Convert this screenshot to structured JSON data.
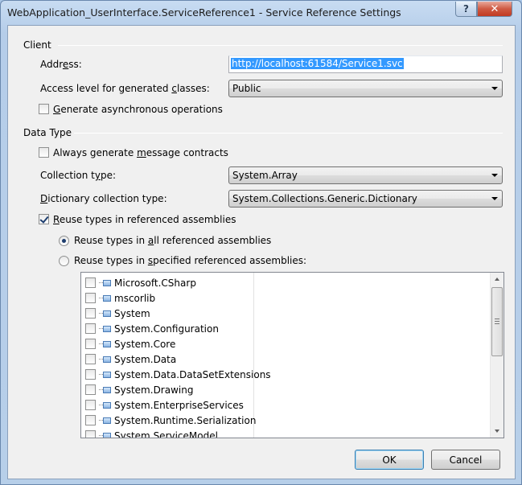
{
  "window": {
    "title": "WebApplication_UserInterface.ServiceReference1 - Service Reference Settings",
    "help_glyph": "?",
    "close_glyph": "✕"
  },
  "client": {
    "section_label": "Client",
    "address_label_pre": "Addr",
    "address_label_u": "e",
    "address_label_post": "ss:",
    "address_value": "http://localhost:61584/Service1.svc",
    "access_label_pre": "Access level for generated ",
    "access_label_u": "c",
    "access_label_post": "lasses:",
    "access_value": "Public",
    "async_u": "G",
    "async_post": "enerate asynchronous operations",
    "async_checked": false
  },
  "data_type": {
    "section_label": "Data Type",
    "message_pre": "Always generate ",
    "message_u": "m",
    "message_post": "essage contracts",
    "message_checked": false,
    "collection_label_pre": "Collection t",
    "collection_label_u": "y",
    "collection_label_post": "pe:",
    "collection_value": "System.Array",
    "dictionary_label_u": "D",
    "dictionary_label_post": "ictionary collection type:",
    "dictionary_value": "System.Collections.Generic.Dictionary",
    "reuse_u": "R",
    "reuse_post": "euse types in referenced assemblies",
    "reuse_checked": true,
    "reuse_all_pre": "Reuse types in ",
    "reuse_all_u": "a",
    "reuse_all_post": "ll referenced assemblies",
    "reuse_all_selected": true,
    "reuse_specified_pre": "Reuse types in ",
    "reuse_specified_u": "s",
    "reuse_specified_post": "pecified referenced assemblies:",
    "reuse_specified_selected": false
  },
  "assemblies": [
    {
      "label": "Microsoft.CSharp",
      "checked": false
    },
    {
      "label": "mscorlib",
      "checked": false
    },
    {
      "label": "System",
      "checked": false
    },
    {
      "label": "System.Configuration",
      "checked": false
    },
    {
      "label": "System.Core",
      "checked": false
    },
    {
      "label": "System.Data",
      "checked": false
    },
    {
      "label": "System.Data.DataSetExtensions",
      "checked": false
    },
    {
      "label": "System.Drawing",
      "checked": false
    },
    {
      "label": "System.EnterpriseServices",
      "checked": false
    },
    {
      "label": "System.Runtime.Serialization",
      "checked": false
    },
    {
      "label": "System.ServiceModel",
      "checked": false
    }
  ],
  "buttons": {
    "ok": "OK",
    "cancel": "Cancel"
  }
}
